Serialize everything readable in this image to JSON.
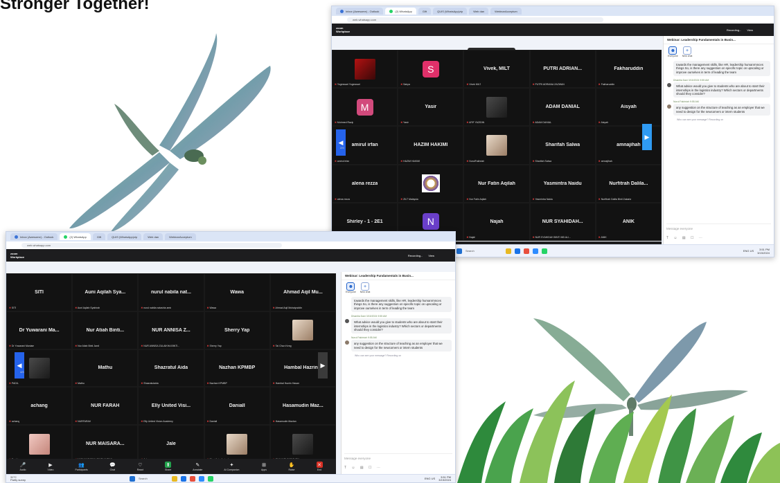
{
  "headline": "Stronger Together!",
  "browser": {
    "tabs": [
      "Inbox (Awesome) - Outlook",
      "(2) WhatsApp",
      "Gift",
      "QUIS (WhatsApp)zip",
      "Web dan",
      "WebinarAcceptum"
    ],
    "url": "web.whatsapp.com"
  },
  "zoom": {
    "brand_line1": "zoom",
    "brand_line2": "Workplace",
    "recording": "Recording...",
    "view": "View",
    "talking": "Darbena Abdillah is talking..."
  },
  "shot1": {
    "page": "2/5",
    "tiles": [
      {
        "name": "",
        "tag": "Yogeswari Yogeswari",
        "kind": "photo-red"
      },
      {
        "name": "S",
        "tag": "Sakya",
        "kind": "avatar",
        "color": "#e0306a"
      },
      {
        "name": "Vivek, MILT",
        "tag": "Vivek MILT"
      },
      {
        "name": "PUTRI ADRIAN...",
        "tag": "PUTRI ADRIANA ZAZWAN"
      },
      {
        "name": "Fakharuddin",
        "tag": "Fakharuddin"
      },
      {
        "name": "M",
        "tag": "Mohmed Razip",
        "kind": "avatar",
        "color": "#d24a7c"
      },
      {
        "name": "Yasir",
        "tag": "Yasir"
      },
      {
        "name": "",
        "tag": "AFIF YAZIDIN",
        "kind": "photo-dark"
      },
      {
        "name": "ADAM DANIAL",
        "tag": "ADAM DANIAL"
      },
      {
        "name": "Aisyah",
        "tag": "Aisyah"
      },
      {
        "name": "amirul irfan",
        "tag": "amirul irfan"
      },
      {
        "name": "HAZIM HAKIMI",
        "tag": "HAZIM HAKIMI"
      },
      {
        "name": "",
        "tag": "NurulFakhriah",
        "kind": "photo-light"
      },
      {
        "name": "Sharifah Salwa",
        "tag": "Sharifah Salwa"
      },
      {
        "name": "amnajihah",
        "tag": "amnajihah"
      },
      {
        "name": "alena rezza",
        "tag": "alena rezza"
      },
      {
        "name": "",
        "tag": "ZILT Malaysia",
        "kind": "logo"
      },
      {
        "name": "Nur Fatin Aqilah",
        "tag": "Nur Fatin Aqilah"
      },
      {
        "name": "Yasmintra Naidu",
        "tag": "Yasmintra Naidu"
      },
      {
        "name": "Nurfitrah Dalila...",
        "tag": "Nurfitrah Dalila Binti Zakaria"
      },
      {
        "name": "Shirley - 1 - 2E1",
        "tag": "Shirley - 1 - 2E1"
      },
      {
        "name": "N",
        "tag": "Nashlah",
        "kind": "avatar",
        "color": "#6a3fc9"
      },
      {
        "name": "Najah",
        "tag": "Najah"
      },
      {
        "name": "NUR SYAHIDAH...",
        "tag": "NUR SYAHIDAH BINTI MD ALI..."
      },
      {
        "name": "ANIK",
        "tag": "ANIK"
      }
    ]
  },
  "shot2": {
    "page": "4/5",
    "tiles": [
      {
        "name": "SITI",
        "tag": "SITI"
      },
      {
        "name": "Auni Aqilah Sya...",
        "tag": "Auni Aqilah Syahirah"
      },
      {
        "name": "nurul nabila nat...",
        "tag": "nurul nabila natashia amir"
      },
      {
        "name": "Wawa",
        "tag": "Wawa"
      },
      {
        "name": "Ahmad Aqil Mu...",
        "tag": "Ahmad Aqil Muhaiyuddin"
      },
      {
        "name": "Dr Yuwarani Ma...",
        "tag": "Dr Yuwarani Maniam"
      },
      {
        "name": "Nur Atiah Binti...",
        "tag": "Nur Atiah Binti Jamil"
      },
      {
        "name": "NUR ANNISA Z...",
        "tag": "NUR ANNISA ZULAIKHA BINTI..."
      },
      {
        "name": "Sherry Yap",
        "tag": "Sherry Yap"
      },
      {
        "name": "",
        "tag": "Tai Chun Keng",
        "kind": "photo-light"
      },
      {
        "name": "",
        "tag": "PADIL",
        "kind": "photo-dark"
      },
      {
        "name": "Mathu",
        "tag": "Mathu"
      },
      {
        "name": "Shazratul Aida",
        "tag": "Shazratulaida"
      },
      {
        "name": "Nazhan KPMBP",
        "tag": "Nazhan KPMBP"
      },
      {
        "name": "Hambal Hazrin...",
        "tag": "Hambal Hazrin Hasan"
      },
      {
        "name": "achang",
        "tag": "achang"
      },
      {
        "name": "NUR FARAH",
        "tag": "NURFARAH"
      },
      {
        "name": "Elly United Visi...",
        "tag": "Elly United Vision Academy"
      },
      {
        "name": "Daniall",
        "tag": "Daniall"
      },
      {
        "name": "Hasamudin Maz...",
        "tag": "Hasamudin Mazlan"
      },
      {
        "name": "",
        "tag": "Sophie",
        "kind": "photo-pink"
      },
      {
        "name": "NUR MAISARA...",
        "tag": "NUR MAISARAH BINTI AMRAN"
      },
      {
        "name": "Jale",
        "tag": "Jale"
      },
      {
        "name": "",
        "tag": "Sheri Azie Aminah",
        "kind": "photo-light"
      },
      {
        "name": "",
        "tag": "SHAHARUNIZAD ZIN",
        "kind": "photo-dark"
      }
    ]
  },
  "chat": {
    "title": "Webinar: Leadership Fundamentals in Busin...",
    "tab_everyone": "Everyone",
    "tab_new": "New chat",
    "msg1": "towards the management skills, like HR, leadership humanrmnces things So, is there any suggestion on specific topic on upscaling or improve ourselves in term of leading the team",
    "sender2": "Dhanilia Dani 3/15/2024 9:55 AM",
    "msg2": "What advice would you give to students who are about to start their internships in the logistics industry? Which sectors or departments should they consider?",
    "sender3": "Nurul Fakhriah 9:55 AM",
    "msg3": "any suggestion on the structure of teaching as an employer that we need to design for the newcomers or intern students",
    "reply_hint": "Who can see your message? Recording on",
    "placeholder": "Message everyone"
  },
  "controls": [
    "Audio",
    "Video",
    "Participants",
    "Chat",
    "React",
    "Share",
    "Annotate",
    "AI Companion",
    "Apps",
    "Raise",
    "End"
  ],
  "participants_count": "101",
  "taskbar": {
    "search": "Search",
    "weather": "31°C",
    "weather_sub": "Partly sunny",
    "lang": "ENG US",
    "time": "3:51 PM",
    "date": "3/15/2024"
  }
}
